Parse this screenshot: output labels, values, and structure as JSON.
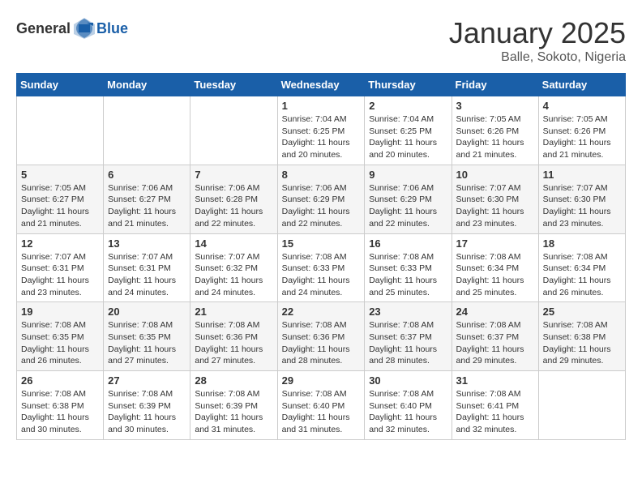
{
  "logo": {
    "general": "General",
    "blue": "Blue"
  },
  "header": {
    "month_year": "January 2025",
    "location": "Balle, Sokoto, Nigeria"
  },
  "days_of_week": [
    "Sunday",
    "Monday",
    "Tuesday",
    "Wednesday",
    "Thursday",
    "Friday",
    "Saturday"
  ],
  "weeks": [
    [
      {
        "day": "",
        "sunrise": "",
        "sunset": "",
        "daylight": "",
        "empty": true
      },
      {
        "day": "",
        "sunrise": "",
        "sunset": "",
        "daylight": "",
        "empty": true
      },
      {
        "day": "",
        "sunrise": "",
        "sunset": "",
        "daylight": "",
        "empty": true
      },
      {
        "day": "1",
        "sunrise": "Sunrise: 7:04 AM",
        "sunset": "Sunset: 6:25 PM",
        "daylight": "Daylight: 11 hours and 20 minutes."
      },
      {
        "day": "2",
        "sunrise": "Sunrise: 7:04 AM",
        "sunset": "Sunset: 6:25 PM",
        "daylight": "Daylight: 11 hours and 20 minutes."
      },
      {
        "day": "3",
        "sunrise": "Sunrise: 7:05 AM",
        "sunset": "Sunset: 6:26 PM",
        "daylight": "Daylight: 11 hours and 21 minutes."
      },
      {
        "day": "4",
        "sunrise": "Sunrise: 7:05 AM",
        "sunset": "Sunset: 6:26 PM",
        "daylight": "Daylight: 11 hours and 21 minutes."
      }
    ],
    [
      {
        "day": "5",
        "sunrise": "Sunrise: 7:05 AM",
        "sunset": "Sunset: 6:27 PM",
        "daylight": "Daylight: 11 hours and 21 minutes."
      },
      {
        "day": "6",
        "sunrise": "Sunrise: 7:06 AM",
        "sunset": "Sunset: 6:27 PM",
        "daylight": "Daylight: 11 hours and 21 minutes."
      },
      {
        "day": "7",
        "sunrise": "Sunrise: 7:06 AM",
        "sunset": "Sunset: 6:28 PM",
        "daylight": "Daylight: 11 hours and 22 minutes."
      },
      {
        "day": "8",
        "sunrise": "Sunrise: 7:06 AM",
        "sunset": "Sunset: 6:29 PM",
        "daylight": "Daylight: 11 hours and 22 minutes."
      },
      {
        "day": "9",
        "sunrise": "Sunrise: 7:06 AM",
        "sunset": "Sunset: 6:29 PM",
        "daylight": "Daylight: 11 hours and 22 minutes."
      },
      {
        "day": "10",
        "sunrise": "Sunrise: 7:07 AM",
        "sunset": "Sunset: 6:30 PM",
        "daylight": "Daylight: 11 hours and 23 minutes."
      },
      {
        "day": "11",
        "sunrise": "Sunrise: 7:07 AM",
        "sunset": "Sunset: 6:30 PM",
        "daylight": "Daylight: 11 hours and 23 minutes."
      }
    ],
    [
      {
        "day": "12",
        "sunrise": "Sunrise: 7:07 AM",
        "sunset": "Sunset: 6:31 PM",
        "daylight": "Daylight: 11 hours and 23 minutes."
      },
      {
        "day": "13",
        "sunrise": "Sunrise: 7:07 AM",
        "sunset": "Sunset: 6:31 PM",
        "daylight": "Daylight: 11 hours and 24 minutes."
      },
      {
        "day": "14",
        "sunrise": "Sunrise: 7:07 AM",
        "sunset": "Sunset: 6:32 PM",
        "daylight": "Daylight: 11 hours and 24 minutes."
      },
      {
        "day": "15",
        "sunrise": "Sunrise: 7:08 AM",
        "sunset": "Sunset: 6:33 PM",
        "daylight": "Daylight: 11 hours and 24 minutes."
      },
      {
        "day": "16",
        "sunrise": "Sunrise: 7:08 AM",
        "sunset": "Sunset: 6:33 PM",
        "daylight": "Daylight: 11 hours and 25 minutes."
      },
      {
        "day": "17",
        "sunrise": "Sunrise: 7:08 AM",
        "sunset": "Sunset: 6:34 PM",
        "daylight": "Daylight: 11 hours and 25 minutes."
      },
      {
        "day": "18",
        "sunrise": "Sunrise: 7:08 AM",
        "sunset": "Sunset: 6:34 PM",
        "daylight": "Daylight: 11 hours and 26 minutes."
      }
    ],
    [
      {
        "day": "19",
        "sunrise": "Sunrise: 7:08 AM",
        "sunset": "Sunset: 6:35 PM",
        "daylight": "Daylight: 11 hours and 26 minutes."
      },
      {
        "day": "20",
        "sunrise": "Sunrise: 7:08 AM",
        "sunset": "Sunset: 6:35 PM",
        "daylight": "Daylight: 11 hours and 27 minutes."
      },
      {
        "day": "21",
        "sunrise": "Sunrise: 7:08 AM",
        "sunset": "Sunset: 6:36 PM",
        "daylight": "Daylight: 11 hours and 27 minutes."
      },
      {
        "day": "22",
        "sunrise": "Sunrise: 7:08 AM",
        "sunset": "Sunset: 6:36 PM",
        "daylight": "Daylight: 11 hours and 28 minutes."
      },
      {
        "day": "23",
        "sunrise": "Sunrise: 7:08 AM",
        "sunset": "Sunset: 6:37 PM",
        "daylight": "Daylight: 11 hours and 28 minutes."
      },
      {
        "day": "24",
        "sunrise": "Sunrise: 7:08 AM",
        "sunset": "Sunset: 6:37 PM",
        "daylight": "Daylight: 11 hours and 29 minutes."
      },
      {
        "day": "25",
        "sunrise": "Sunrise: 7:08 AM",
        "sunset": "Sunset: 6:38 PM",
        "daylight": "Daylight: 11 hours and 29 minutes."
      }
    ],
    [
      {
        "day": "26",
        "sunrise": "Sunrise: 7:08 AM",
        "sunset": "Sunset: 6:38 PM",
        "daylight": "Daylight: 11 hours and 30 minutes."
      },
      {
        "day": "27",
        "sunrise": "Sunrise: 7:08 AM",
        "sunset": "Sunset: 6:39 PM",
        "daylight": "Daylight: 11 hours and 30 minutes."
      },
      {
        "day": "28",
        "sunrise": "Sunrise: 7:08 AM",
        "sunset": "Sunset: 6:39 PM",
        "daylight": "Daylight: 11 hours and 31 minutes."
      },
      {
        "day": "29",
        "sunrise": "Sunrise: 7:08 AM",
        "sunset": "Sunset: 6:40 PM",
        "daylight": "Daylight: 11 hours and 31 minutes."
      },
      {
        "day": "30",
        "sunrise": "Sunrise: 7:08 AM",
        "sunset": "Sunset: 6:40 PM",
        "daylight": "Daylight: 11 hours and 32 minutes."
      },
      {
        "day": "31",
        "sunrise": "Sunrise: 7:08 AM",
        "sunset": "Sunset: 6:41 PM",
        "daylight": "Daylight: 11 hours and 32 minutes."
      },
      {
        "day": "",
        "sunrise": "",
        "sunset": "",
        "daylight": "",
        "empty": true
      }
    ]
  ]
}
